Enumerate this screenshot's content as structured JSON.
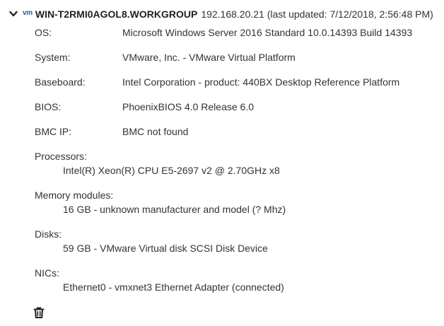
{
  "host": {
    "badge": "vm",
    "name": "WIN-T2RMI0AGOL8.WORKGROUP",
    "meta": "192.168.20.21 (last updated: 7/12/2018, 2:56:48 PM)"
  },
  "details": [
    {
      "label": "OS:",
      "value": "Microsoft Windows Server 2016 Standard 10.0.14393 Build 14393"
    },
    {
      "label": "System:",
      "value": "VMware, Inc. - VMware Virtual Platform"
    },
    {
      "label": "Baseboard:",
      "value": "Intel Corporation - product: 440BX Desktop Reference Platform"
    },
    {
      "label": "BIOS:",
      "value": "PhoenixBIOS 4.0 Release 6.0"
    },
    {
      "label": "BMC IP:",
      "value": "BMC not found"
    }
  ],
  "sections": [
    {
      "label": "Processors:",
      "value": "Intel(R) Xeon(R) CPU E5-2697 v2 @ 2.70GHz x8"
    },
    {
      "label": "Memory modules:",
      "value": "16 GB - unknown manufacturer and model (? Mhz)"
    },
    {
      "label": "Disks:",
      "value": "59 GB - VMware Virtual disk SCSI Disk Device"
    },
    {
      "label": "NICs:",
      "value": "Ethernet0 - vmxnet3 Ethernet Adapter (connected)"
    }
  ],
  "icons": {
    "expand": "chevron-down-icon",
    "delete": "trash-icon"
  }
}
